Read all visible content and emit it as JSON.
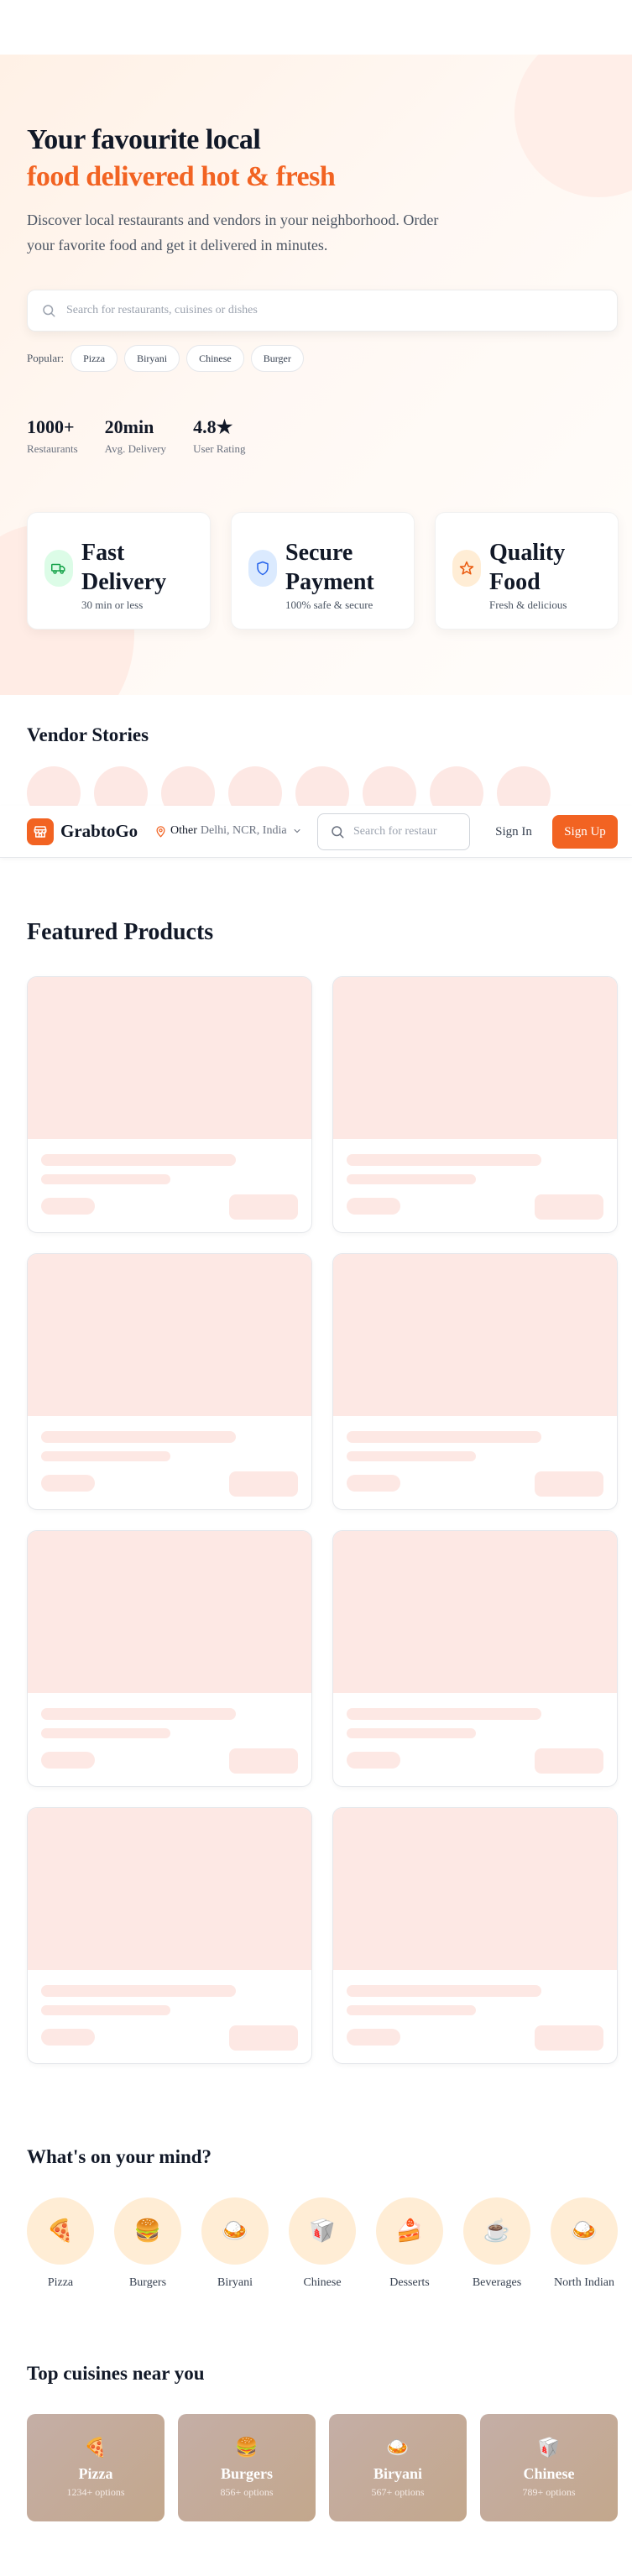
{
  "hero": {
    "title_line1": "Your favourite local",
    "title_line2": "food delivered hot & fresh",
    "description": "Discover local restaurants and vendors in your neighborhood. Order your favorite food and get it delivered in minutes.",
    "search_placeholder": "Search for restaurants, cuisines or dishes",
    "popular_label": "Popular:",
    "popular_items": [
      "Pizza",
      "Biryani",
      "Chinese",
      "Burger"
    ],
    "stats": [
      {
        "value": "1000+",
        "label": "Restaurants"
      },
      {
        "value": "20min",
        "label": "Avg. Delivery"
      },
      {
        "value": "4.8★",
        "label": "User Rating"
      }
    ],
    "features": [
      {
        "title": "Fast Delivery",
        "subtitle": "30 min or less",
        "icon": "truck-icon"
      },
      {
        "title": "Secure Payment",
        "subtitle": "100% safe & secure",
        "icon": "shield-icon"
      },
      {
        "title": "Quality Food",
        "subtitle": "Fresh & delicious",
        "icon": "star-icon"
      }
    ]
  },
  "vendor_stories": {
    "title": "Vendor Stories",
    "count": 8
  },
  "navbar": {
    "brand": "GrabtoGo",
    "location_name": "Other",
    "location_area": "Delhi, NCR, India",
    "search_placeholder": "Search for restaurants",
    "signin_label": "Sign In",
    "signup_label": "Sign Up"
  },
  "featured": {
    "title": "Featured Products",
    "skeleton_cards": 8
  },
  "mind": {
    "title": "What's on your mind?",
    "items": [
      {
        "label": "Pizza",
        "icon": "🍕"
      },
      {
        "label": "Burgers",
        "icon": "🍔"
      },
      {
        "label": "Biryani",
        "icon": "🍛"
      },
      {
        "label": "Chinese",
        "icon": "🥡"
      },
      {
        "label": "Desserts",
        "icon": "🍰"
      },
      {
        "label": "Beverages",
        "icon": "☕"
      },
      {
        "label": "North Indian",
        "icon": "🍛"
      }
    ]
  },
  "cuisines": {
    "title": "Top cuisines near you",
    "items": [
      {
        "name": "Pizza",
        "count": "1234+ options",
        "icon": "🍕"
      },
      {
        "name": "Burgers",
        "count": "856+ options",
        "icon": "🍔"
      },
      {
        "name": "Biryani",
        "count": "567+ options",
        "icon": "🍛"
      },
      {
        "name": "Chinese",
        "count": "789+ options",
        "icon": "🥡"
      }
    ]
  },
  "colors": {
    "accent": "#f26322",
    "skeleton": "#fde8e4",
    "hero_bg": "#fff3ea"
  }
}
